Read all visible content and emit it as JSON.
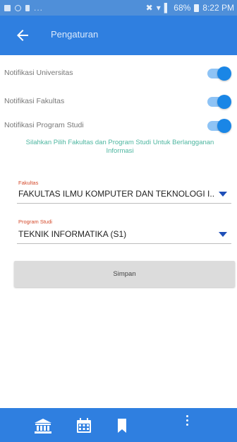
{
  "status_bar": {
    "left_dots": "...",
    "battery": "68%",
    "time": "8:22 PM"
  },
  "app_bar": {
    "title": "Pengaturan",
    "back_icon": "arrow-left-icon"
  },
  "toggles": [
    {
      "label": "Notifikasi Universitas",
      "on": true
    },
    {
      "label": "Notifikasi Fakultas",
      "on": true
    },
    {
      "label": "Notifikasi Program Studi",
      "on": true
    }
  ],
  "info_text": "Silahkan Pilih Fakultas dan Program Studi Untuk Berlangganan Informasi",
  "fakultas": {
    "label": "Fakultas",
    "value": "FAKULTAS ILMU KOMPUTER DAN TEKNOLOGI I.."
  },
  "program_studi": {
    "label": "Program Studi",
    "value": "TEKNIK INFORMATIKA (S1)"
  },
  "save_button": "Simpan",
  "bottom_nav": {
    "icons": [
      "university-icon",
      "calendar-icon",
      "bookmark-icon",
      "more-vert-icon"
    ]
  },
  "colors": {
    "primary": "#2f7fe0",
    "status_bar": "#4f8fd9",
    "switch_on": "#1a86e6",
    "info_text": "#4db6a0",
    "field_label": "#d44a2b",
    "select_arrow": "#1f4fb8"
  }
}
